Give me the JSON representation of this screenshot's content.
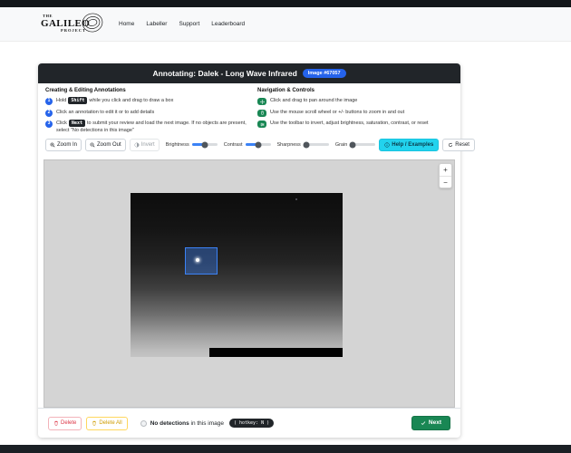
{
  "nav": {
    "logo": {
      "the": "THE",
      "galileo": "GALILEO",
      "project": "PROJECT"
    },
    "items": [
      {
        "label": "Home"
      },
      {
        "label": "Labeller"
      },
      {
        "label": "Support"
      },
      {
        "label": "Leaderboard"
      }
    ]
  },
  "header": {
    "title": "Annotating: Dalek - Long Wave Infrared",
    "image_badge": "Image #67057"
  },
  "instructions": {
    "creating": {
      "title": "Creating & Editing Annotations",
      "item1": {
        "num": "1",
        "pre": "Hold",
        "kbd": "Shift",
        "post": "while you click and drag to draw a box"
      },
      "item2": {
        "num": "2",
        "text": "Click an annotation to edit it or to add details"
      },
      "item3": {
        "num": "3",
        "pre": "Click",
        "kbd": "Next",
        "post": "to submit your review and load the next image. If no objects are present, select \"No detections in this image\""
      }
    },
    "navigation": {
      "title": "Navigation & Controls",
      "item1": {
        "icon": "pan-icon",
        "text": "Click and drag to pan around the image"
      },
      "item2": {
        "icon": "mouse-scroll-icon",
        "text": "Use the mouse scroll wheel or +/- buttons to zoom in and out"
      },
      "item3": {
        "icon": "toolbar-icon",
        "text": "Use the toolbar to invert, adjust brightness, saturation, contrast, or reset"
      }
    }
  },
  "toolbar": {
    "zoom_in": "Zoom In",
    "zoom_out": "Zoom Out",
    "invert": "Invert",
    "sliders": [
      {
        "label": "Brightness",
        "fill": "50%",
        "knob": "50%"
      },
      {
        "label": "Contrast",
        "fill": "50%",
        "knob": "50%"
      },
      {
        "label": "Sharpness",
        "fill": "10%",
        "knob": "10%"
      },
      {
        "label": "Grain",
        "fill": "10%",
        "knob": "10%"
      }
    ],
    "help": "Help / Examples",
    "reset": "Reset"
  },
  "canvas": {
    "zoom_plus": "+",
    "zoom_minus": "−"
  },
  "bottom_bar": {
    "delete": "Delete",
    "delete_all": "Delete All",
    "no_detections_bold": "No detections",
    "no_detections_rest": " in this image",
    "hotkey": "( hotkey: N )",
    "next": "Next"
  },
  "colors": {
    "accent_blue": "#2563eb",
    "success_green": "#198754",
    "help_cyan": "#22d3ee",
    "danger_red": "#dc3545",
    "warning_amber": "#ffc107",
    "header_dark": "#212529"
  }
}
